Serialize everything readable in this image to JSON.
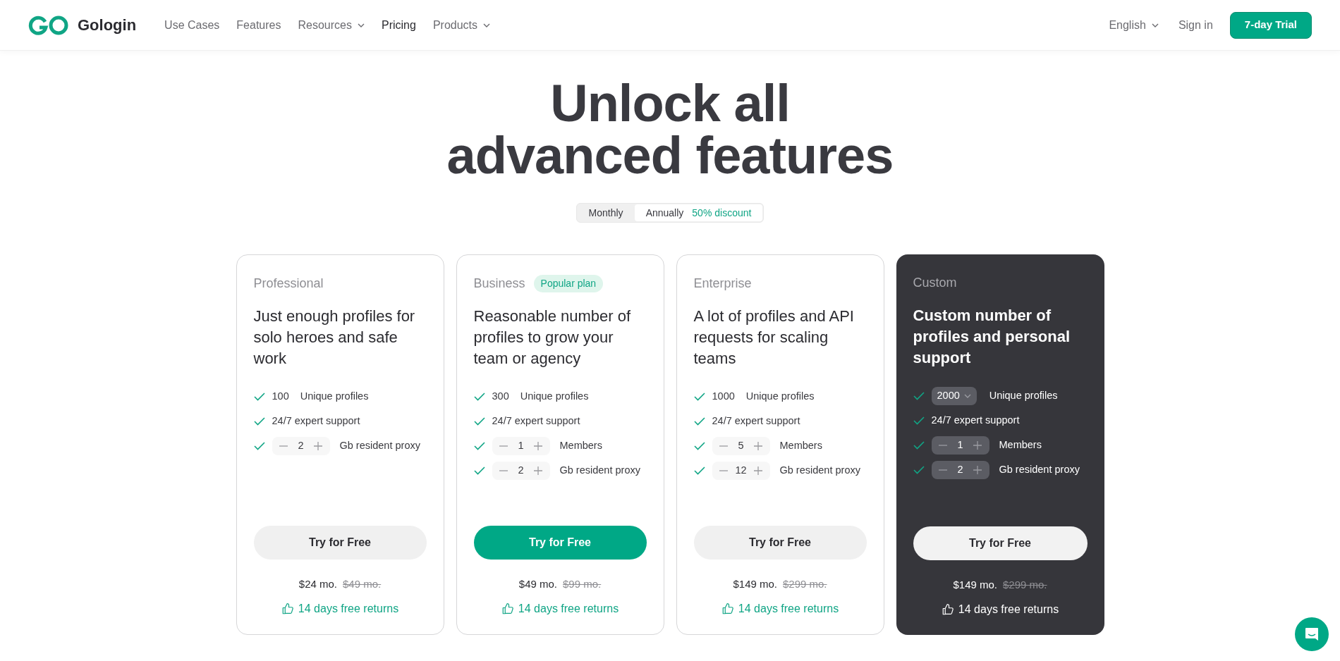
{
  "header": {
    "logo": "Gologin",
    "nav": [
      {
        "label": "Use Cases",
        "has_menu": false,
        "selected": false
      },
      {
        "label": "Features",
        "has_menu": false,
        "selected": false
      },
      {
        "label": "Resources",
        "has_menu": true,
        "selected": false
      },
      {
        "label": "Pricing",
        "has_menu": false,
        "selected": true
      },
      {
        "label": "Products",
        "has_menu": true,
        "selected": false
      }
    ],
    "language": "English",
    "sign_in": "Sign in",
    "trial_button": "7-day Trial"
  },
  "hero": {
    "title_lines": [
      "Unlock all",
      "advanced features"
    ]
  },
  "billing_toggle": {
    "options": [
      {
        "label": "Monthly",
        "selected": false
      },
      {
        "label": "Annually",
        "selected": true
      }
    ],
    "discount": "50% discount"
  },
  "plans": [
    {
      "name": "Professional",
      "kind": "light",
      "description": "Just enough profiles for solo heroes and safe work",
      "features": [
        {
          "kind": "count",
          "value": "100",
          "label": "Unique profiles"
        },
        {
          "kind": "plain",
          "label": "24/7 expert support"
        },
        {
          "kind": "stepper",
          "quantity": "2",
          "label": "Gb resident proxy"
        }
      ],
      "button": {
        "label": "Try for Free",
        "primary": false
      },
      "price": "$24 mo.",
      "old_price": "$49 mo.",
      "returns": "14 days free returns"
    },
    {
      "name": "Business",
      "badge": "Popular plan",
      "kind": "light",
      "description": "Reasonable number of profiles to grow your team or agency",
      "features": [
        {
          "kind": "count",
          "value": "300",
          "label": "Unique profiles"
        },
        {
          "kind": "plain",
          "label": "24/7 expert support"
        },
        {
          "kind": "stepper",
          "quantity": "1",
          "label": "Members"
        },
        {
          "kind": "stepper",
          "quantity": "2",
          "label": "Gb resident proxy"
        }
      ],
      "button": {
        "label": "Try for Free",
        "primary": true
      },
      "price": "$49 mo.",
      "old_price": "$99 mo.",
      "returns": "14 days free returns"
    },
    {
      "name": "Enterprise",
      "kind": "light",
      "description": "A lot of profiles and API requests for scaling teams",
      "features": [
        {
          "kind": "count",
          "value": "1000",
          "label": "Unique profiles"
        },
        {
          "kind": "plain",
          "label": "24/7 expert support"
        },
        {
          "kind": "stepper",
          "quantity": "5",
          "label": "Members"
        },
        {
          "kind": "stepper",
          "quantity": "12",
          "label": "Gb resident proxy"
        }
      ],
      "button": {
        "label": "Try for Free",
        "primary": false
      },
      "price": "$149 mo.",
      "old_price": "$299 mo.",
      "returns": "14 days free returns"
    },
    {
      "name": "Custom",
      "kind": "dark",
      "description": "Custom number of profiles and personal support",
      "features": [
        {
          "kind": "select",
          "value": "2000",
          "label": "Unique profiles"
        },
        {
          "kind": "plain",
          "label": "24/7 expert support"
        },
        {
          "kind": "stepper",
          "quantity": "1",
          "label": "Members"
        },
        {
          "kind": "stepper",
          "quantity": "2",
          "label": "Gb resident proxy"
        }
      ],
      "button": {
        "label": "Try for Free",
        "primary": false
      },
      "price": "$149 mo.",
      "old_price": "$299 mo.",
      "returns": "14 days free returns"
    }
  ]
}
